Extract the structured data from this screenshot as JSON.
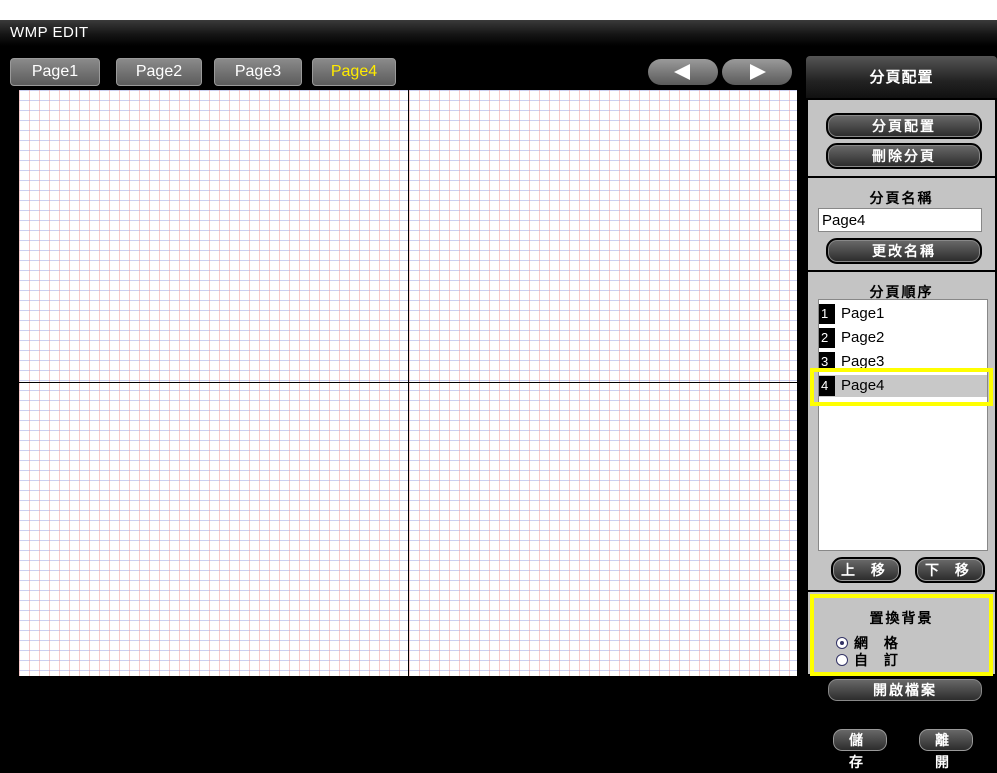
{
  "window": {
    "title": "WMP EDIT"
  },
  "tabs": [
    {
      "label": "Page1",
      "active": false
    },
    {
      "label": "Page2",
      "active": false
    },
    {
      "label": "Page3",
      "active": false
    },
    {
      "label": "Page4",
      "active": true
    }
  ],
  "nav": {
    "prev_icon": "left-triangle-icon",
    "next_icon": "right-triangle-icon"
  },
  "sidebar": {
    "header": "分頁配置",
    "layout_button": "分頁配置",
    "delete_button": "刪除分頁",
    "name_label": "分頁名稱",
    "name_value": "Page4",
    "rename_button": "更改名稱",
    "order_label": "分頁順序",
    "order_list": [
      {
        "num": "1",
        "name": "Page1"
      },
      {
        "num": "2",
        "name": "Page2"
      },
      {
        "num": "3",
        "name": "Page3"
      },
      {
        "num": "4",
        "name": "Page4"
      }
    ],
    "selected_index": 3,
    "move_up_button": "上 移",
    "move_down_button": "下 移",
    "background_label": "置換背景",
    "background_options": [
      {
        "label": "網 格",
        "checked": true
      },
      {
        "label": "自 訂",
        "checked": false
      }
    ],
    "open_file_button": "開啟檔案",
    "save_button": "儲 存",
    "exit_button": "離 開"
  },
  "colors": {
    "highlight": "#ffff00",
    "active_tab_text": "#ffeb00"
  }
}
